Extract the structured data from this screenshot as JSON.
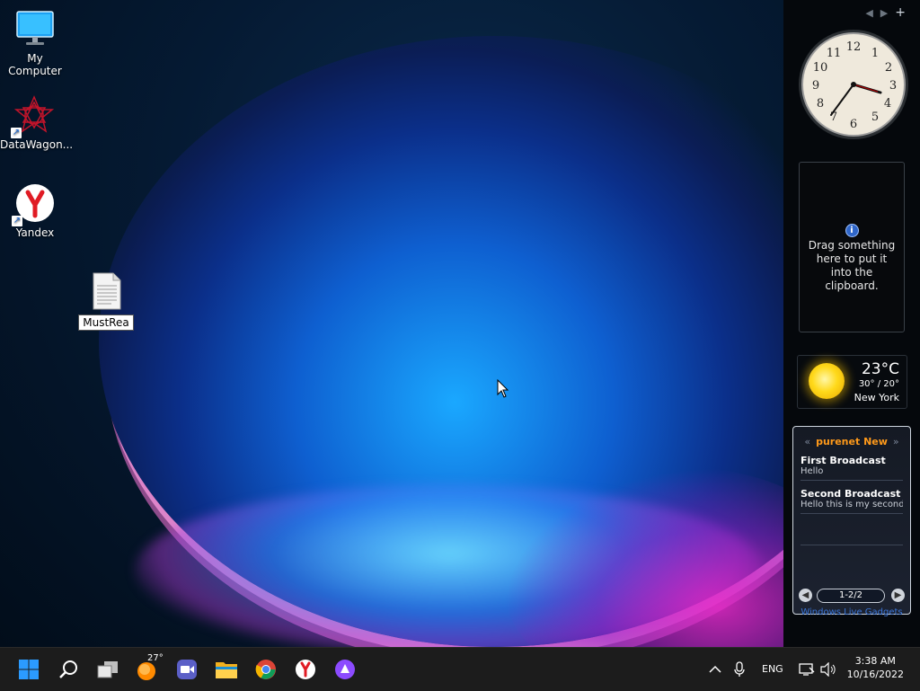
{
  "desktop": {
    "icons": [
      {
        "label": "My Computer"
      },
      {
        "label": "DataWagon..."
      },
      {
        "label": "Yandex"
      },
      {
        "label": "MustRea"
      }
    ]
  },
  "sidebar": {
    "clipboard_gadget": {
      "text": "Drag something here to put it into the clipboard."
    },
    "weather": {
      "temp": "23°C",
      "range": "30° / 20°",
      "city": "New York"
    },
    "feed": {
      "title": "purenet New",
      "items": [
        {
          "headline": "First Broadcast",
          "body": "Hello"
        },
        {
          "headline": "Second Broadcast",
          "body": "Hello this is my second"
        }
      ],
      "page": "1-2/2",
      "footer_link": "Windows Live Gadgets"
    }
  },
  "taskbar": {
    "weather_badge": "27°",
    "language": "ENG",
    "time": "3:38 AM",
    "date": "10/16/2022",
    "pinned": [
      "start-icon",
      "search-icon",
      "task-view-icon",
      "weather-icon",
      "meet-icon",
      "file-explorer-icon",
      "chrome-icon",
      "yandex-icon",
      "alice-icon"
    ]
  },
  "colors": {
    "feed_title": "#ff9a1a",
    "start_blue": "#2b9bff",
    "taskbar": "#1c1c1c"
  }
}
